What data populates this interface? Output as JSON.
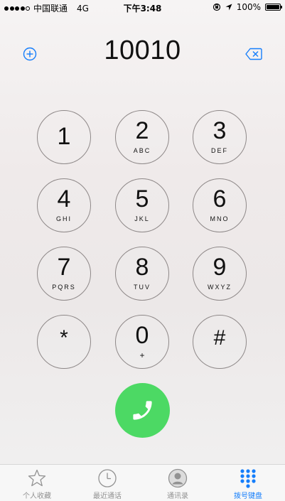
{
  "status_bar": {
    "carrier": "中国联通",
    "network": "4G",
    "time": "下午3:48",
    "battery_percent": "100%",
    "signal_bars": 4,
    "signal_total": 5
  },
  "dialer": {
    "number": "10010",
    "add_icon": "plus-circle-icon",
    "delete_icon": "delete-backspace-icon"
  },
  "keypad": [
    {
      "digit": "1",
      "letters": ""
    },
    {
      "digit": "2",
      "letters": "ABC"
    },
    {
      "digit": "3",
      "letters": "DEF"
    },
    {
      "digit": "4",
      "letters": "GHI"
    },
    {
      "digit": "5",
      "letters": "JKL"
    },
    {
      "digit": "6",
      "letters": "MNO"
    },
    {
      "digit": "7",
      "letters": "PQRS"
    },
    {
      "digit": "8",
      "letters": "TUV"
    },
    {
      "digit": "9",
      "letters": "WXYZ"
    },
    {
      "digit": "*",
      "letters": ""
    },
    {
      "digit": "0",
      "letters": "+"
    },
    {
      "digit": "#",
      "letters": ""
    }
  ],
  "call_button": {
    "icon": "phone-icon",
    "color": "#4CD964"
  },
  "tab_bar": {
    "tabs": [
      {
        "label": "个人收藏",
        "icon": "star-icon",
        "active": false
      },
      {
        "label": "最近通话",
        "icon": "clock-icon",
        "active": false
      },
      {
        "label": "通讯录",
        "icon": "contacts-icon",
        "active": false
      },
      {
        "label": "拨号键盘",
        "icon": "keypad-icon",
        "active": true
      }
    ],
    "active_color": "#157EFB",
    "inactive_color": "#929292"
  }
}
